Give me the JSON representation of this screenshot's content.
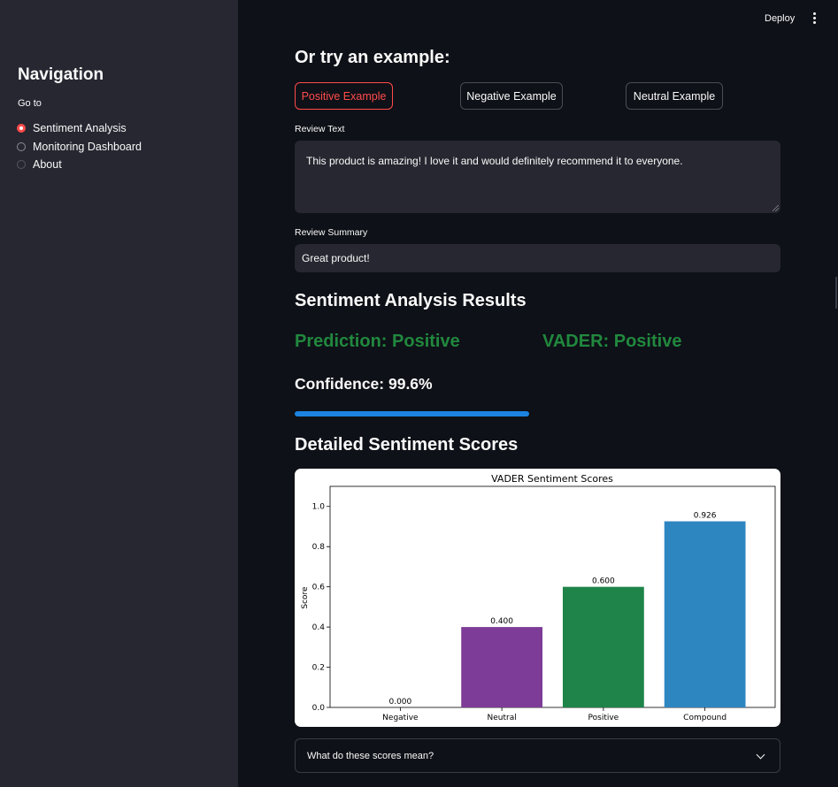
{
  "sidebar": {
    "title": "Navigation",
    "goto_label": "Go to",
    "items": [
      {
        "label": "Sentiment Analysis",
        "checked": true
      },
      {
        "label": "Monitoring Dashboard",
        "checked": false
      },
      {
        "label": "About",
        "checked": false
      }
    ]
  },
  "topbar": {
    "deploy_label": "Deploy",
    "menu_icon": "kebab-menu-icon"
  },
  "main": {
    "examples_heading": "Or try an example:",
    "buttons": {
      "positive": "Positive Example",
      "negative": "Negative Example",
      "neutral": "Neutral Example"
    },
    "review_text_label": "Review Text",
    "review_text_value": "This product is amazing! I love it and would definitely recommend it to everyone.",
    "review_summary_label": "Review Summary",
    "review_summary_value": "Great product!",
    "results_heading": "Sentiment Analysis Results",
    "prediction_text": "Prediction: Positive",
    "vader_text": "VADER: Positive",
    "confidence_text": "Confidence: 99.6%",
    "confidence_value": 0.996,
    "detailed_heading": "Detailed Sentiment Scores",
    "expander_label": "What do these scores mean?"
  },
  "colors": {
    "accent": "#ff4b4b",
    "positive_text": "#21883e",
    "progress": "#1c83e1"
  },
  "chart_data": {
    "type": "bar",
    "title": "VADER Sentiment Scores",
    "xlabel": "",
    "ylabel": "Score",
    "categories": [
      "Negative",
      "Neutral",
      "Positive",
      "Compound"
    ],
    "values": [
      0.0,
      0.4,
      0.6,
      0.926
    ],
    "value_labels": [
      "0.000",
      "0.400",
      "0.600",
      "0.926"
    ],
    "colors": [
      "#e74c3c",
      "#7d3c98",
      "#1e8449",
      "#2e86c1"
    ],
    "ylim": [
      0,
      1.1
    ],
    "yticks": [
      "0.0",
      "0.2",
      "0.4",
      "0.6",
      "0.8",
      "1.0"
    ],
    "grid": false
  }
}
